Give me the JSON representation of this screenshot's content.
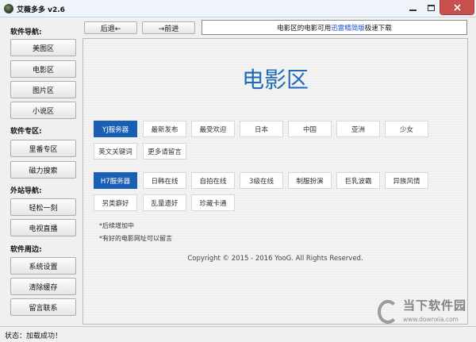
{
  "window": {
    "title": "艾薇多多 v2.6"
  },
  "sidebar": {
    "sections": [
      {
        "heading": "软件导航:",
        "items": [
          "美图区",
          "电影区",
          "图片区",
          "小说区"
        ]
      },
      {
        "heading": "软件专区:",
        "items": [
          "里番专区",
          "磁力搜索"
        ]
      },
      {
        "heading": "外站导航:",
        "items": [
          "轻松一刻",
          "电视直播"
        ]
      },
      {
        "heading": "软件周边:",
        "items": [
          "系统设置",
          "清除缓存",
          "留言联系"
        ]
      }
    ]
  },
  "toolbar": {
    "back_label": "后退←",
    "forward_label": "→前进"
  },
  "notice": {
    "prefix": "电影区的电影可用",
    "link": "迅雷精简版",
    "suffix": "极速下载"
  },
  "content": {
    "title": "电影区",
    "group1": [
      "YJ服务器",
      "最新发布",
      "最受欢迎",
      "日本",
      "中国",
      "亚洲",
      "少女",
      "英文关键词",
      "更多请留言"
    ],
    "group2": [
      "H7服务器",
      "日韩在线",
      "自拍在线",
      "3级在线",
      "制服扮演",
      "巨乳波霸",
      "异族风情",
      "另类癖好",
      "乱量遗奸",
      "珍藏卡通"
    ],
    "notes": [
      "*后续增加中",
      "*有好的电影网址可以留言"
    ],
    "copyright": "Copyright © 2015 - 2016 YooG. All Rights Reserved."
  },
  "watermark": {
    "brand": "当下软件园",
    "url": "www.downxia.com"
  },
  "status": {
    "text": "状态：加载成功！"
  },
  "colors": {
    "accent": "#1a5fb4",
    "title": "#1e6ab8",
    "close": "#c74f4f",
    "link": "#1a4fd6"
  }
}
